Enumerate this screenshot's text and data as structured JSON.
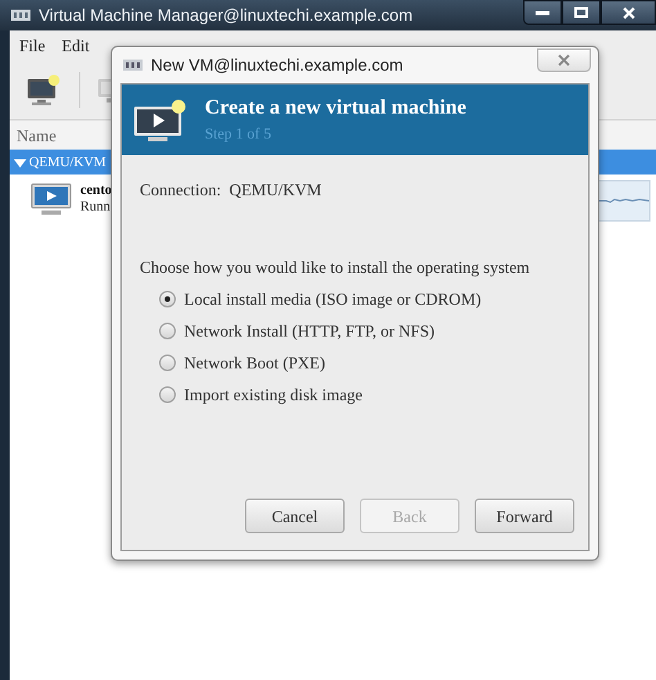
{
  "window": {
    "title": "Virtual Machine Manager@linuxtechi.example.com"
  },
  "menu": [
    "File",
    "Edit"
  ],
  "list": {
    "column": "Name",
    "groups": [
      {
        "label": "QEMU/KVM",
        "expanded": true,
        "vms": [
          {
            "name": "cento",
            "status": "Runn"
          }
        ]
      }
    ]
  },
  "dialog": {
    "title": "New VM@linuxtechi.example.com",
    "header": {
      "title": "Create a new virtual machine",
      "step": "Step 1 of 5"
    },
    "connection": {
      "label": "Connection:",
      "value": "QEMU/KVM"
    },
    "prompt": "Choose how you would like to install the operating system",
    "options": [
      {
        "label": "Local install media (ISO image or CDROM)",
        "selected": true
      },
      {
        "label": "Network Install (HTTP, FTP, or NFS)",
        "selected": false
      },
      {
        "label": "Network Boot (PXE)",
        "selected": false
      },
      {
        "label": "Import existing disk image",
        "selected": false
      }
    ],
    "buttons": [
      {
        "label": "Cancel",
        "disabled": false
      },
      {
        "label": "Back",
        "disabled": true
      },
      {
        "label": "Forward",
        "disabled": false
      }
    ]
  }
}
